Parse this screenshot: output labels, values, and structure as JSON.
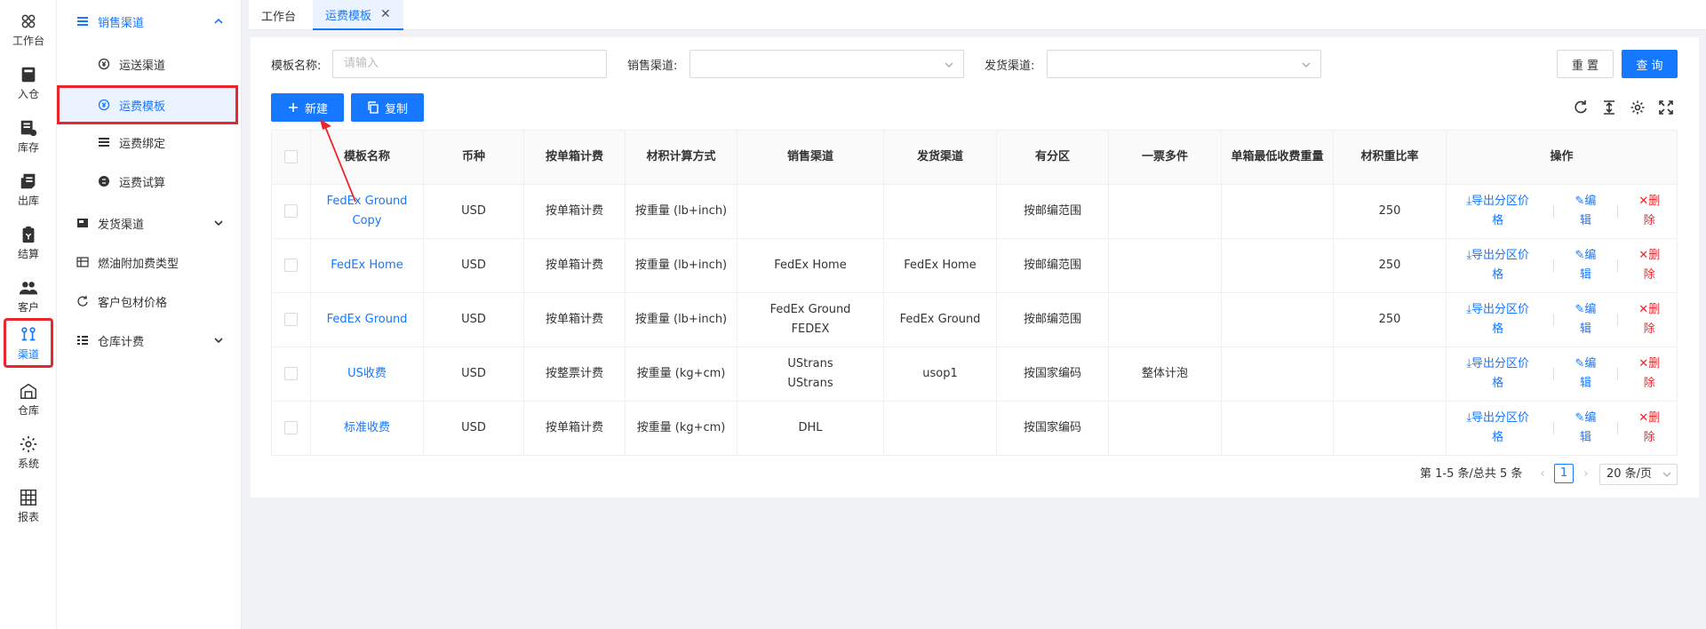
{
  "rail": [
    {
      "label": "工作台",
      "icon": "workbench-icon"
    },
    {
      "label": "入仓",
      "icon": "inbound-icon"
    },
    {
      "label": "库存",
      "icon": "inventory-icon"
    },
    {
      "label": "出库",
      "icon": "outbound-icon"
    },
    {
      "label": "结算",
      "icon": "settlement-icon"
    },
    {
      "label": "客户",
      "icon": "customer-icon"
    },
    {
      "label": "渠道",
      "icon": "channel-icon",
      "active": true
    },
    {
      "label": "仓库",
      "icon": "warehouse-icon"
    },
    {
      "label": "系统",
      "icon": "gear-icon"
    },
    {
      "label": "报表",
      "icon": "report-icon"
    }
  ],
  "submenu": {
    "sales_channel": "销售渠道",
    "transport_channel": "运送渠道",
    "freight_template": "运费模板",
    "freight_binding": "运费绑定",
    "freight_trial": "运费试算",
    "shipping_channel": "发货渠道",
    "fuel_surcharge_type": "燃油附加费类型",
    "customer_packaging_price": "客户包材价格",
    "warehouse_billing": "仓库计费"
  },
  "tabs": {
    "workbench": "工作台",
    "freight_template": "运费模板",
    "close_glyph": "✕"
  },
  "filters": {
    "template_name_label": "模板名称:",
    "template_name_placeholder": "请输入",
    "sales_channel_label": "销售渠道:",
    "shipping_channel_label": "发货渠道:"
  },
  "buttons": {
    "reset": "重 置",
    "query": "查 询",
    "create": "新建",
    "copy": "复制"
  },
  "table": {
    "headers": [
      "模板名称",
      "币种",
      "按单箱计费",
      "材积计算方式",
      "销售渠道",
      "发货渠道",
      "有分区",
      "一票多件",
      "单箱最低收费重量",
      "材积重比率",
      "操作"
    ],
    "rows": [
      {
        "name": "FedEx Ground Copy",
        "currency": "USD",
        "billing": "按单箱计费",
        "calc": "按重量 (lb+inch)",
        "sales": "",
        "shipping": "",
        "zone": "按邮编范围",
        "multi": "",
        "min_weight": "",
        "ratio": "250"
      },
      {
        "name": "FedEx Home",
        "currency": "USD",
        "billing": "按单箱计费",
        "calc": "按重量 (lb+inch)",
        "sales": "FedEx Home",
        "shipping": "FedEx Home",
        "zone": "按邮编范围",
        "multi": "",
        "min_weight": "",
        "ratio": "250"
      },
      {
        "name": "FedEx Ground",
        "currency": "USD",
        "billing": "按单箱计费",
        "calc": "按重量 (lb+inch)",
        "sales": "FedEx Ground\nFEDEX",
        "shipping": "FedEx Ground",
        "zone": "按邮编范围",
        "multi": "",
        "min_weight": "",
        "ratio": "250"
      },
      {
        "name": "US收费",
        "currency": "USD",
        "billing": "按整票计费",
        "calc": "按重量 (kg+cm)",
        "sales": "UStrans\nUStrans",
        "shipping": "usop1",
        "zone": "按国家编码",
        "multi": "整体计泡",
        "min_weight": "",
        "ratio": ""
      },
      {
        "name": "标准收费",
        "currency": "USD",
        "billing": "按单箱计费",
        "calc": "按重量 (kg+cm)",
        "sales": "DHL",
        "shipping": "",
        "zone": "按国家编码",
        "multi": "",
        "min_weight": "",
        "ratio": ""
      }
    ],
    "ops": {
      "export": "⤓导出分区价格",
      "edit": "✎编辑",
      "delete": "✕删除"
    }
  },
  "pagination": {
    "summary": "第 1-5 条/总共 5 条",
    "prev": "‹",
    "next": "›",
    "current": "1",
    "page_size": "20 条/页"
  },
  "colors": {
    "primary": "#1677ff",
    "annotation_red": "#e8262c"
  }
}
